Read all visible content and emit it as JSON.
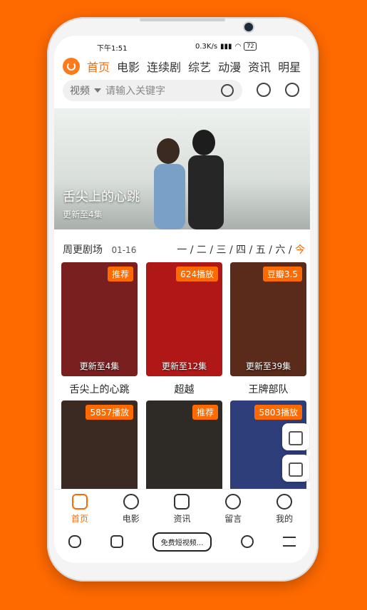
{
  "status": {
    "time": "下午1:51",
    "speed": "0.3K/s",
    "battery": "72"
  },
  "nav": {
    "tabs": [
      "首页",
      "电影",
      "连续剧",
      "综艺",
      "动漫",
      "资讯",
      "明星"
    ]
  },
  "search": {
    "category": "视频",
    "placeholder": "请输入关键字"
  },
  "banner": {
    "title": "舌尖上的心跳",
    "subtitle": "更新至4集"
  },
  "weekly": {
    "title": "周更剧场",
    "date": "01-16",
    "days": [
      "一",
      "二",
      "三",
      "四",
      "五",
      "六"
    ],
    "today": "今"
  },
  "cards": [
    {
      "name": "舌尖上的心跳",
      "badge": "推荐",
      "update": "更新至4集",
      "color": "#7a1f1f"
    },
    {
      "name": "超越",
      "badge": "624播放",
      "update": "更新至12集",
      "color": "#b01818"
    },
    {
      "name": "王牌部队",
      "badge": "豆瓣3.5",
      "update": "更新至39集",
      "color": "#5a2a1a"
    },
    {
      "name": "",
      "badge": "5857播放",
      "update": "",
      "color": "#3a2a22"
    },
    {
      "name": "",
      "badge": "推荐",
      "update": "",
      "color": "#2e2a26"
    },
    {
      "name": "",
      "badge": "5803播放",
      "update": "",
      "color": "#2d3e7a"
    }
  ],
  "bottom_nav": [
    {
      "label": "首页",
      "icon": "home-icon"
    },
    {
      "label": "电影",
      "icon": "film-reel-icon"
    },
    {
      "label": "资讯",
      "icon": "news-icon"
    },
    {
      "label": "留言",
      "icon": "message-icon"
    },
    {
      "label": "我的",
      "icon": "profile-icon"
    }
  ],
  "browser_bar": {
    "chip": "免费短视频..."
  },
  "colors": {
    "accent": "#ff6a00"
  }
}
